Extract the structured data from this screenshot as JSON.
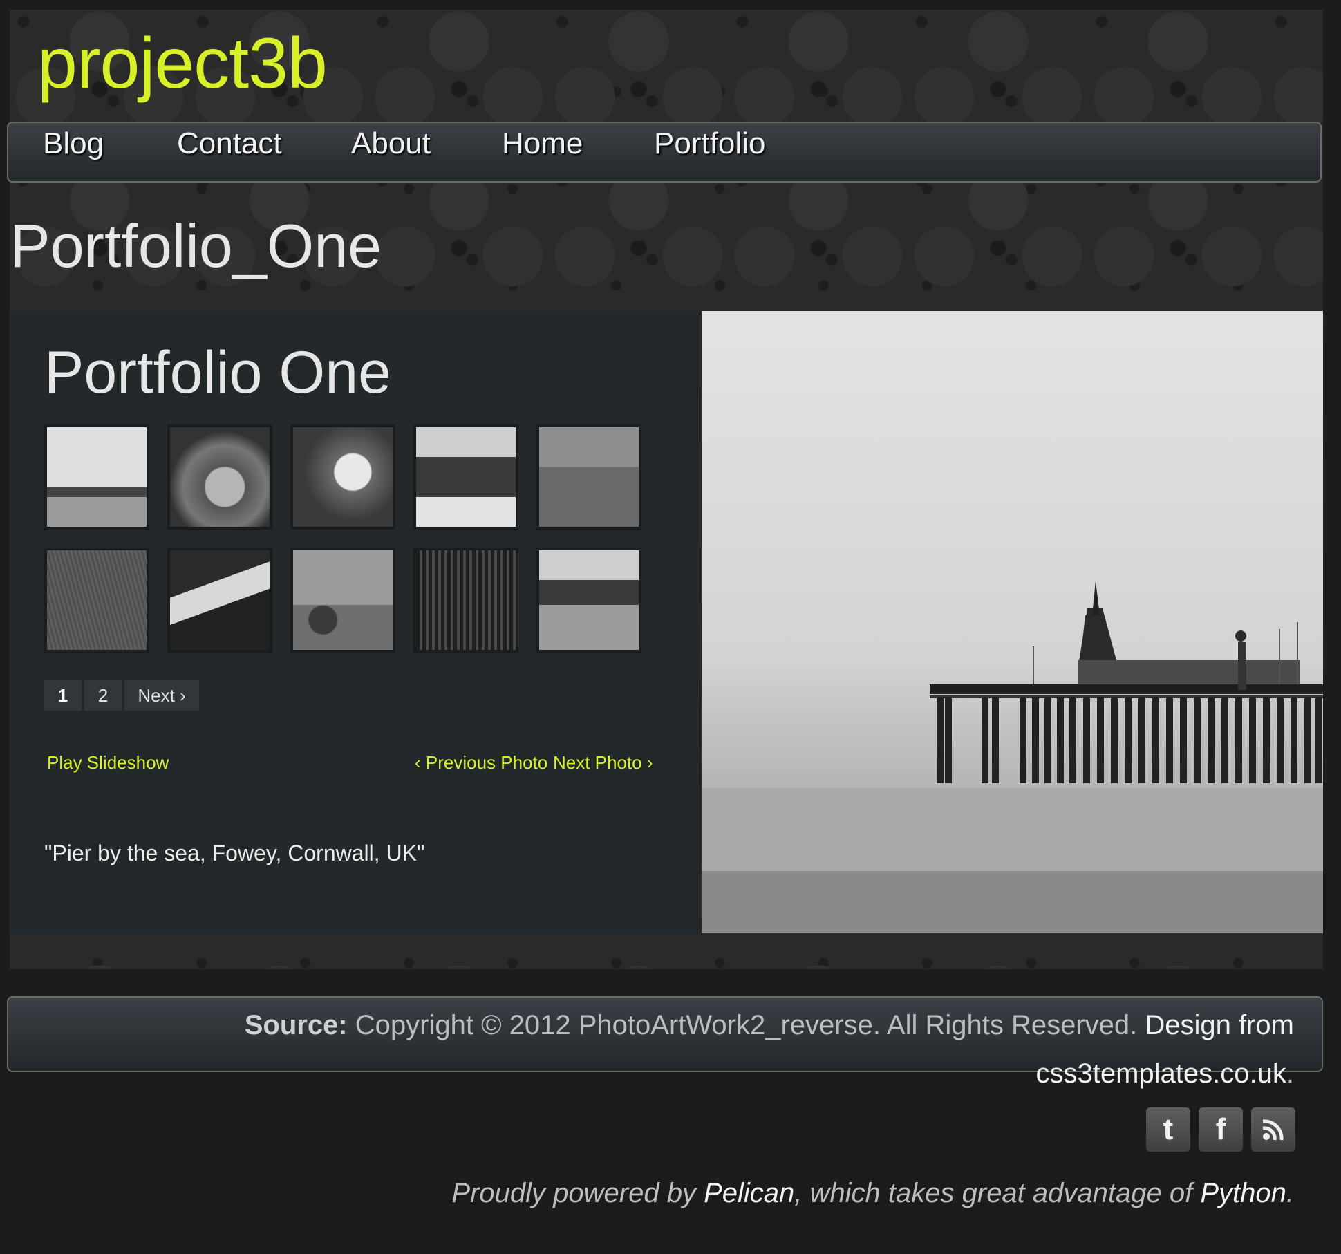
{
  "site": {
    "title": "project3b"
  },
  "nav": {
    "items": [
      {
        "label": "Blog"
      },
      {
        "label": "Contact"
      },
      {
        "label": "About"
      },
      {
        "label": "Home"
      },
      {
        "label": "Portfolio"
      }
    ]
  },
  "page": {
    "title": "Portfolio_One"
  },
  "gallery": {
    "title": "Portfolio One",
    "thumbnails": [
      "pier",
      "toy",
      "flower",
      "caravan",
      "sailboat",
      "grass",
      "pipe",
      "fountain",
      "trees",
      "coast"
    ],
    "pagination": {
      "current": "1",
      "next_page": "2",
      "next_label": "Next ›"
    },
    "play_slideshow": "Play Slideshow",
    "prev_photo": "‹ Previous Photo",
    "next_photo": "Next Photo ›",
    "caption": "\"Pier by the sea, Fowey, Cornwall, UK\""
  },
  "footer": {
    "source_label": "Source:",
    "copyright": "Copyright © 2012 PhotoArtWork2_reverse. All Rights Reserved.",
    "design_from": "Design from",
    "design_link": "css3templates.co.uk",
    "period": ".",
    "social": [
      {
        "icon": "twitter-icon",
        "glyph": "t"
      },
      {
        "icon": "facebook-icon",
        "glyph": "f"
      },
      {
        "icon": "rss-icon",
        "glyph": ""
      }
    ],
    "powered_prefix": "Proudly powered by",
    "pelican": "Pelican",
    "powered_middle": ", which takes great advantage of",
    "python": "Python",
    "powered_suffix": "."
  },
  "colors": {
    "accent": "#d8f02a",
    "background": "#1a1c1e",
    "panel": "#23282b"
  }
}
